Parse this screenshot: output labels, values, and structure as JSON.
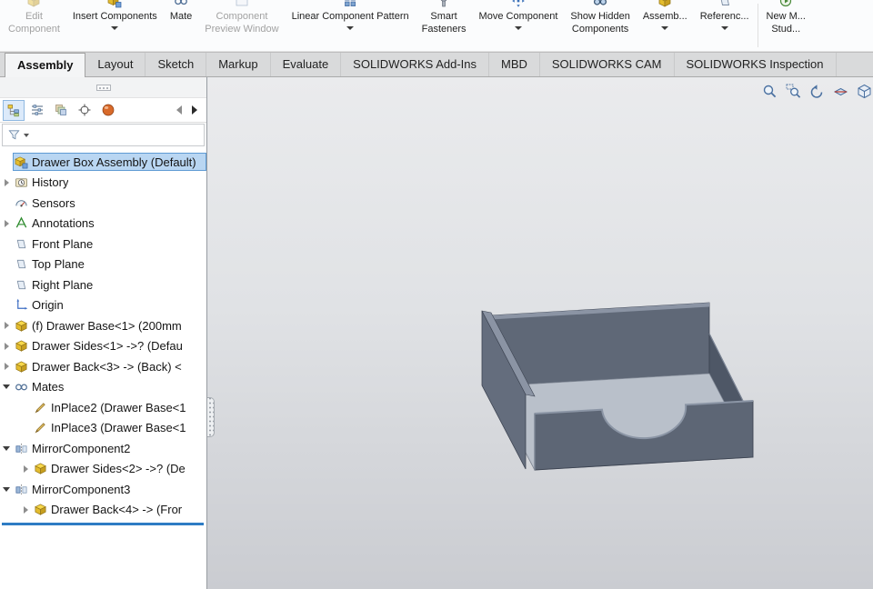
{
  "toolbar": {
    "buttons": [
      {
        "line1": "Edit",
        "line2": "Component",
        "disabled": true,
        "dropdown": false
      },
      {
        "line1": "Insert Components",
        "line2": "",
        "disabled": false,
        "dropdown": true
      },
      {
        "line1": "Mate",
        "line2": "",
        "disabled": false,
        "dropdown": false
      },
      {
        "line1": "Component",
        "line2": "Preview Window",
        "disabled": true,
        "dropdown": false
      },
      {
        "line1": "Linear Component Pattern",
        "line2": "",
        "disabled": false,
        "dropdown": true
      },
      {
        "line1": "Smart",
        "line2": "Fasteners",
        "disabled": false,
        "dropdown": false
      },
      {
        "line1": "Move Component",
        "line2": "",
        "disabled": false,
        "dropdown": true
      },
      {
        "line1": "Show Hidden",
        "line2": "Components",
        "disabled": false,
        "dropdown": false
      },
      {
        "line1": "Assemb...",
        "line2": "",
        "disabled": false,
        "dropdown": true
      },
      {
        "line1": "Referenc...",
        "line2": "",
        "disabled": false,
        "dropdown": true
      },
      {
        "line1": "New M...",
        "line2": "Stud...",
        "disabled": false,
        "dropdown": false
      }
    ]
  },
  "ribbon_tabs": {
    "active": "Assembly",
    "items": [
      {
        "label": "Assembly"
      },
      {
        "label": "Layout"
      },
      {
        "label": "Sketch"
      },
      {
        "label": "Markup"
      },
      {
        "label": "Evaluate"
      },
      {
        "label": "SOLIDWORKS Add-Ins"
      },
      {
        "label": "MBD"
      },
      {
        "label": "SOLIDWORKS CAM"
      },
      {
        "label": "SOLIDWORKS Inspection"
      }
    ]
  },
  "panel": {
    "manager_tabs": [
      "FeatureManager design tree",
      "PropertyManager",
      "ConfigurationManager",
      "DimXpertManager",
      "DisplayManager"
    ]
  },
  "feature_tree": {
    "items": [
      {
        "label": "Drawer Box Assembly (Default)",
        "icon": "assembly-icon",
        "selected": true
      },
      {
        "label": "History",
        "icon": "history-icon"
      },
      {
        "label": "Sensors",
        "icon": "sensors-icon"
      },
      {
        "label": "Annotations",
        "icon": "annotations-icon"
      },
      {
        "label": "Front Plane",
        "icon": "plane-icon"
      },
      {
        "label": "Top Plane",
        "icon": "plane-icon"
      },
      {
        "label": "Right Plane",
        "icon": "plane-icon"
      },
      {
        "label": "Origin",
        "icon": "origin-icon"
      },
      {
        "label": "(f) Drawer Base<1> (200mm",
        "icon": "part-icon"
      },
      {
        "label": "Drawer Sides<1> ->? (Defau",
        "icon": "part-icon"
      },
      {
        "label": "Drawer Back<3> -> (Back) <",
        "icon": "part-icon"
      },
      {
        "label": "Mates",
        "icon": "mates-icon"
      },
      {
        "label": "InPlace2 (Drawer Base<1",
        "icon": "inplace-mate-icon"
      },
      {
        "label": "InPlace3 (Drawer Base<1",
        "icon": "inplace-mate-icon"
      },
      {
        "label": "MirrorComponent2",
        "icon": "mirror-component-icon"
      },
      {
        "label": "Drawer Sides<2> ->? (De",
        "icon": "part-icon"
      },
      {
        "label": "MirrorComponent3",
        "icon": "mirror-component-icon"
      },
      {
        "label": "Drawer Back<4> -> (Fror",
        "icon": "part-icon"
      }
    ]
  },
  "viewport": {
    "hud": [
      "Zoom to Fit",
      "Zoom to Area",
      "Previous View",
      "Section View",
      "View Orientation"
    ],
    "model": {
      "name": "Drawer Box",
      "panel_color": "#5d6675",
      "bottom_color": "#b9c0ca",
      "edge_color": "#3d4452",
      "highlight_color": "#8b95a5"
    }
  },
  "colors": {
    "selection_bg": "#b9d6f2",
    "selection_border": "#5f9bd4",
    "tree_end_bar": "#2e7cc4",
    "tab_active_bg": "#f4f5f6"
  }
}
